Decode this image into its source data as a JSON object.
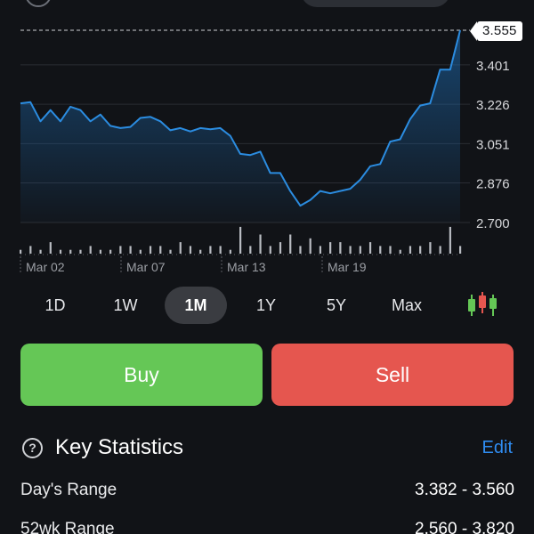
{
  "chart_data": {
    "type": "line",
    "current_price": "3.555",
    "y_ticks": [
      "3.401",
      "3.226",
      "3.051",
      "2.876",
      "2.700"
    ],
    "y_tick_values": [
      3.401,
      3.226,
      3.051,
      2.876,
      2.7
    ],
    "ylim": [
      2.7,
      3.555
    ],
    "x_labels": [
      "Mar 02",
      "Mar 07",
      "Mar 13",
      "Mar 19"
    ],
    "values": [
      3.23,
      3.235,
      3.15,
      3.2,
      3.15,
      3.215,
      3.2,
      3.15,
      3.18,
      3.13,
      3.12,
      3.125,
      3.165,
      3.17,
      3.15,
      3.11,
      3.12,
      3.105,
      3.12,
      3.115,
      3.12,
      3.085,
      3.005,
      3.0,
      3.015,
      2.92,
      2.92,
      2.84,
      2.775,
      2.8,
      2.84,
      2.83,
      2.84,
      2.85,
      2.89,
      2.95,
      2.96,
      3.06,
      3.07,
      3.16,
      3.22,
      3.23,
      3.38,
      3.38,
      3.555
    ],
    "volumes": [
      1,
      2,
      1,
      3,
      1,
      1,
      1,
      2,
      1,
      1,
      2,
      2,
      1,
      2,
      2,
      1,
      3,
      2,
      1,
      2,
      2,
      1,
      7,
      2,
      5,
      2,
      3,
      5,
      2,
      4,
      2,
      3,
      3,
      2,
      2,
      3,
      2,
      2,
      1,
      2,
      2,
      3,
      2,
      7,
      2
    ],
    "color": "#2b8ce0",
    "grid": true
  },
  "ranges": {
    "items": [
      {
        "label": "1D",
        "active": false
      },
      {
        "label": "1W",
        "active": false
      },
      {
        "label": "1M",
        "active": true
      },
      {
        "label": "1Y",
        "active": false
      },
      {
        "label": "5Y",
        "active": false
      },
      {
        "label": "Max",
        "active": false
      }
    ],
    "chart_style_icon": "candlestick-icon"
  },
  "actions": {
    "buy_label": "Buy",
    "sell_label": "Sell",
    "buy_color": "#65c756",
    "sell_color": "#e5564f"
  },
  "key_statistics": {
    "title": "Key Statistics",
    "edit_label": "Edit",
    "help_icon": "help-circle-icon",
    "help_glyph": "?",
    "rows": [
      {
        "label": "Day's Range",
        "value": "3.382 - 3.560"
      },
      {
        "label": "52wk Range",
        "value": "2.560 - 3.820"
      }
    ]
  },
  "colors": {
    "background": "#111317",
    "accent": "#2f8cf1"
  }
}
